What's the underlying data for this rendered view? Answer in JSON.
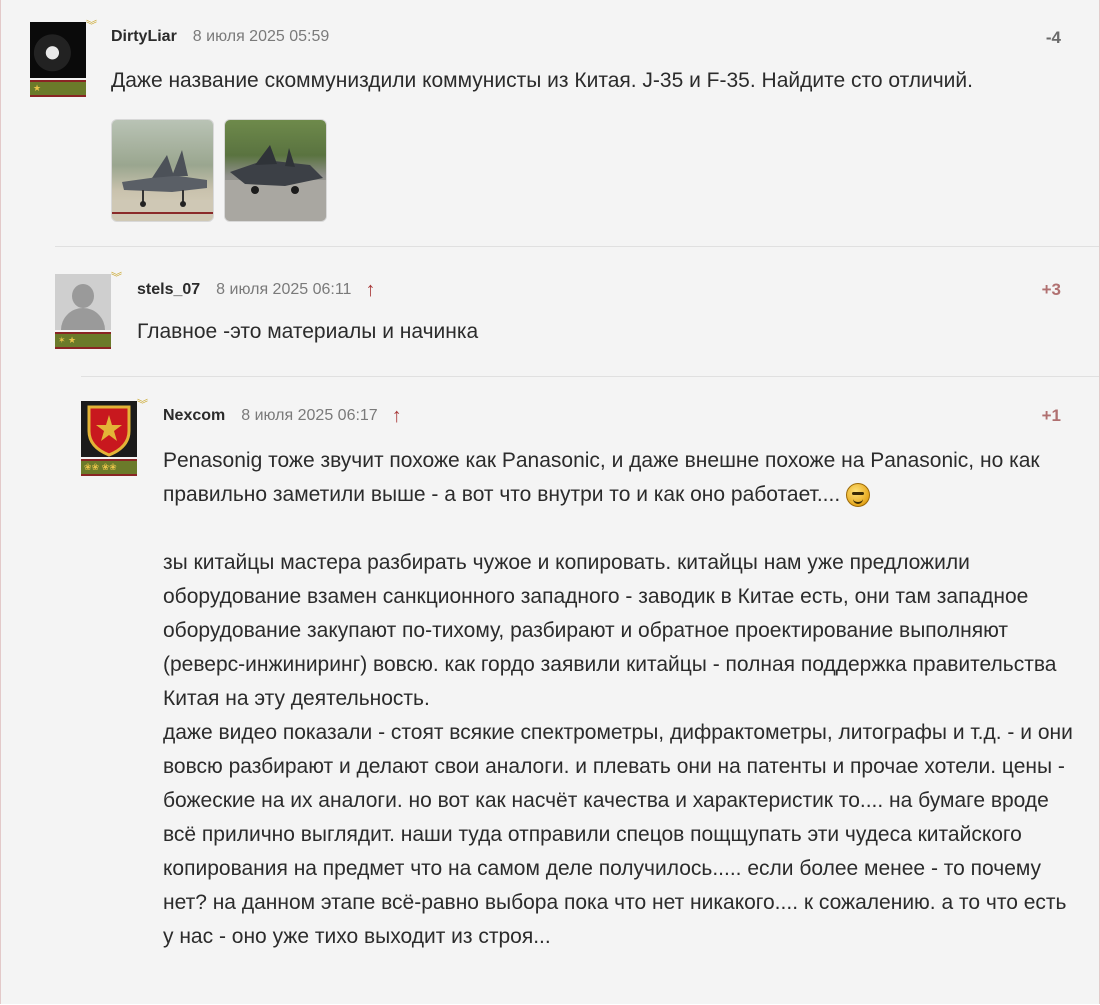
{
  "comments": [
    {
      "username": "DirtyLiar",
      "date": "8 июля 2025 05:59",
      "score": "-4",
      "text": "Даже название скоммуниздили коммунисты из Китая. J-35 и F-35. Найдите сто отличий.",
      "attachments": [
        "jet-photo-1",
        "jet-photo-2"
      ],
      "rank_badge": "rank-insignia"
    },
    {
      "username": "stels_07",
      "date": "8 июля 2025 06:11",
      "score": "+3",
      "text": "Главное -это материалы и начинка",
      "reply_icon": "up-arrow-icon",
      "rank_badge": "rank-insignia"
    },
    {
      "username": "Nexcom",
      "date": "8 июля 2025 06:17",
      "score": "+1",
      "reply_icon": "up-arrow-icon",
      "rank_badge": "rank-insignia",
      "paragraph1": "Penasonig тоже звучит похоже как Panasonic, и даже внешне похоже на Panasonic, но как правильно заметили выше - а вот что внутри то и как оно работает....",
      "paragraph2": "зы китайцы мастера разбирать чужое и копировать. китайцы нам уже предложили оборудование взамен санкционного западного - заводик в Китае есть, они там западное оборудование закупают по-тихому, разбирают и обратное проектирование выполняют (реверс-инжиниринг) вовсю. как гордо заявили китайцы - полная поддержка правительства Китая на эту деятельность.",
      "paragraph3": "даже видео показали - стоят всякие спектрометры, дифрактометры, литографы и т.д. - и они вовсю разбирают и делают свои аналоги. и плевать они на патенты и прочае хотели. цены - божеские на их аналоги. но вот как насчёт качества и характеристик то.... на бумаге вроде всё прилично выглядит. наши туда отправили спецов пощщупать эти чудеса китайского копирования на предмет что на самом деле получилось..... если более менее - то почему нет? на данном этапе всё-равно выбора пока что нет никакого.... к сожалению. а то что есть у нас - оно уже тихо выходит из строя..."
    }
  ],
  "colors": {
    "positive_score": "#b07070",
    "negative_score": "#6a6a6a",
    "reply_arrow": "#a83a3a",
    "background": "#f4f4f4"
  }
}
